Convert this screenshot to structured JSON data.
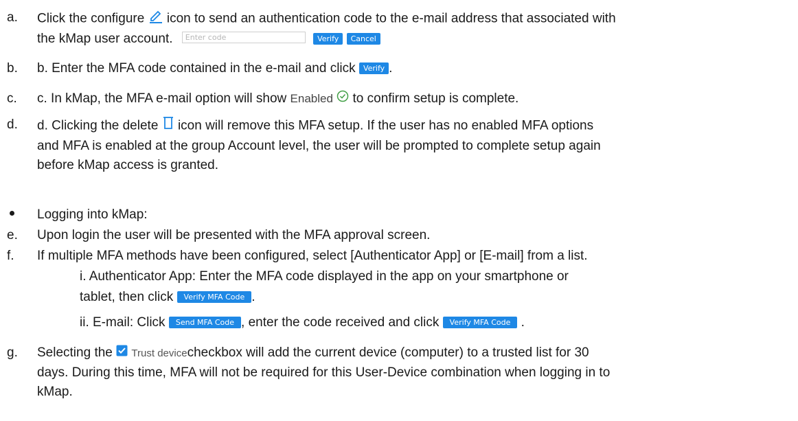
{
  "items": {
    "a": {
      "marker": "a.",
      "part1": "Click the configure",
      "part2": "icon to send an authentication code to the e-mail address that associated with",
      "part3": "the kMap user account.",
      "input_placeholder": "Enter code",
      "verify_label": "Verify",
      "cancel_label": "Cancel"
    },
    "b": {
      "marker": "b.",
      "part1": "b. Enter the MFA code contained in the e-mail and click",
      "verify_label": "Verify",
      "part2": "."
    },
    "c": {
      "marker": "c.",
      "part1": "c. In kMap, the MFA e-mail option will show",
      "enabled_label": "Enabled",
      "part2": "to confirm setup is complete."
    },
    "d": {
      "marker": "d.",
      "part1": "d. Clicking the delete",
      "part2": "icon will remove this MFA setup. If the user has no enabled MFA options",
      "line2": "and MFA is enabled at the group Account level, the user will be prompted to complete setup again",
      "line3": "before kMap access is granted."
    },
    "bullet": {
      "text": "Logging into kMap:"
    },
    "e": {
      "marker": "e.",
      "text": "Upon login the user will be presented with the MFA approval screen."
    },
    "f": {
      "marker": "f.",
      "text": "If multiple MFA methods have been configured, select [Authenticator App] or [E-mail] from a list."
    },
    "fi": {
      "line1": "i. Authenticator App: Enter the MFA code displayed in the app on your smartphone or",
      "line2a": "tablet, then click",
      "button_label": "Verify MFA Code",
      "line2b": "."
    },
    "fii": {
      "part1": "ii. E-mail: Click",
      "send_label": "Send MFA Code",
      "part2": ", enter the code received and click",
      "verify_label": "Verify MFA Code",
      "part3": "."
    },
    "g": {
      "marker": "g.",
      "part1": "Selecting the",
      "trust_label": "Trust device",
      "part2": "checkbox will add the current device (computer) to a trusted list for 30",
      "line2": "days. During this time, MFA will not be required for this User-Device combination when logging in to",
      "line3": "kMap."
    }
  },
  "colors": {
    "button_blue": "#1e88e5",
    "icon_blue": "#1e88e5",
    "enabled_green": "#43a047"
  },
  "icons": {
    "configure": "pencil-icon",
    "delete": "trash-icon",
    "enabled": "check-circle-icon",
    "trust": "checkbox-checked-icon"
  }
}
